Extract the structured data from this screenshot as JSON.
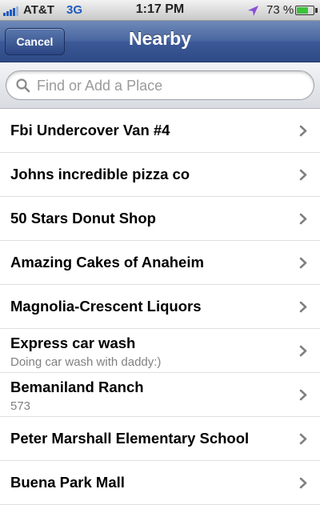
{
  "status_bar": {
    "carrier": "AT&T",
    "network": "3G",
    "time": "1:17 PM",
    "battery_percent": "73 %",
    "battery_level": 0.73,
    "location_icon": "location-arrow-icon"
  },
  "nav": {
    "cancel_label": "Cancel",
    "title": "Nearby"
  },
  "search": {
    "placeholder": "Find or Add a Place",
    "value": ""
  },
  "places": [
    {
      "name": "Fbi Undercover Van #4",
      "subtitle": ""
    },
    {
      "name": "Johns incredible pizza co",
      "subtitle": ""
    },
    {
      "name": "50 Stars Donut Shop",
      "subtitle": ""
    },
    {
      "name": "Amazing Cakes of Anaheim",
      "subtitle": ""
    },
    {
      "name": "Magnolia-Crescent Liquors",
      "subtitle": ""
    },
    {
      "name": "Express car wash",
      "subtitle": "Doing car wash with daddy:)"
    },
    {
      "name": "Bemaniland Ranch",
      "subtitle": "573"
    },
    {
      "name": "Peter Marshall Elementary School",
      "subtitle": ""
    },
    {
      "name": "Buena Park Mall",
      "subtitle": ""
    }
  ],
  "colors": {
    "nav_blue": "#3b5998",
    "signal_blue": "#1f5bbf",
    "battery_green": "#3cc33c",
    "location_purple": "#8a4fd8"
  }
}
